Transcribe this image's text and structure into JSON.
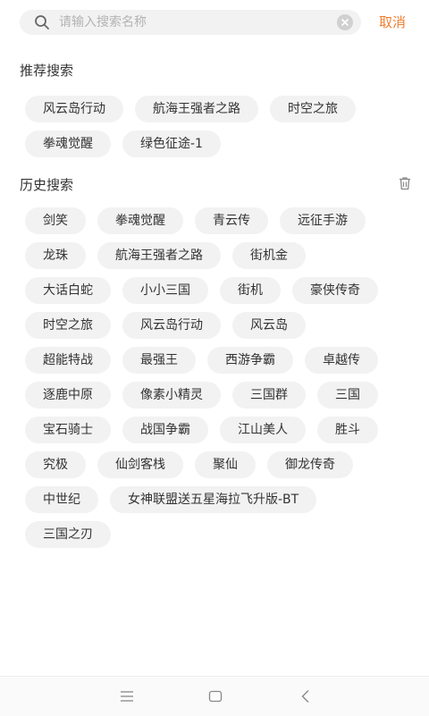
{
  "search": {
    "placeholder": "请输入搜索名称",
    "value": "",
    "cancel_label": "取消"
  },
  "recommended": {
    "title": "推荐搜索",
    "tags": [
      "风云岛行动",
      "航海王强者之路",
      "时空之旅",
      "拳魂觉醒",
      "绿色征途-1"
    ]
  },
  "history": {
    "title": "历史搜索",
    "tags": [
      "剑笑",
      "拳魂觉醒",
      "青云传",
      "远征手游",
      "龙珠",
      "航海王强者之路",
      "街机金",
      "大话白蛇",
      "小小三国",
      "街机",
      "豪侠传奇",
      "时空之旅",
      "风云岛行动",
      "风云岛",
      "超能特战",
      "最强王",
      "西游争霸",
      "卓越传",
      "逐鹿中原",
      "像素小精灵",
      "三国群",
      "三国",
      "宝石骑士",
      "战国争霸",
      "江山美人",
      "胜斗",
      "究极",
      "仙剑客栈",
      "聚仙",
      "御龙传奇",
      "中世纪",
      "女神联盟送五星海拉飞升版-BT",
      "三国之刃"
    ]
  },
  "colors": {
    "accent": "#ef7d2e",
    "tag_bg": "#f2f2f2",
    "text": "#333333"
  },
  "icons": {
    "search": "search-icon",
    "clear": "clear-icon",
    "trash": "trash-icon",
    "menu": "menu-icon",
    "home": "home-icon",
    "back": "back-icon"
  }
}
